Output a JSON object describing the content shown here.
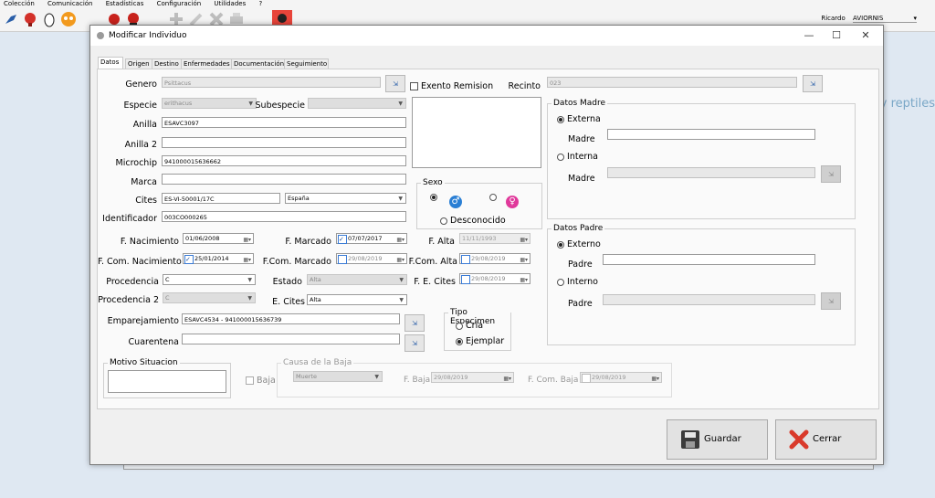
{
  "menubar": [
    "Colección",
    "Comunicación",
    "Estadísticas",
    "Configuración",
    "Utilidades",
    "?"
  ],
  "user": {
    "name": "Ricardo",
    "org": "AVIORNIS"
  },
  "background_text": "y reptiles",
  "dialog": {
    "title": "Modificar Individuo",
    "tabs": [
      "Datos",
      "Origen",
      "Destino",
      "Enfermedades",
      "Documentación",
      "Seguimiento"
    ],
    "active_tab": "Datos"
  },
  "labels": {
    "genero": "Genero",
    "especie": "Especie",
    "subespecie": "Subespecie",
    "anilla": "Anilla",
    "anilla2": "Anilla 2",
    "microchip": "Microchip",
    "marca": "Marca",
    "cites": "Cites",
    "identificador": "Identificador",
    "exento": "Exento Remision",
    "recinto": "Recinto",
    "sexo": "Sexo",
    "desconocido": "Desconocido",
    "f_nacimiento": "F. Nacimiento",
    "f_marcado": "F. Marcado",
    "f_alta": "F. Alta",
    "f_com_nacimiento": "F. Com. Nacimiento",
    "f_com_marcado": "F.Com. Marcado",
    "f_com_alta": "F.Com. Alta",
    "procedencia": "Procedencia",
    "estado": "Estado",
    "f_e_cites": "F. E. Cites",
    "procedencia2": "Procedencia 2",
    "e_cites": "E. Cites",
    "emparejamiento": "Emparejamiento",
    "cuarentena": "Cuarentena",
    "tipo_especimen": "Tipo Especimen",
    "cria": "Cria",
    "ejemplar": "Ejemplar",
    "motivo_situacion": "Motivo Situacion",
    "baja": "Baja",
    "causa_baja": "Causa de la Baja",
    "f_baja": "F. Baja",
    "f_com_baja": "F. Com. Baja"
  },
  "values": {
    "genero": "Psittacus",
    "especie": "erithacus",
    "subespecie": "",
    "anilla": "ESAVC3097",
    "anilla2": "",
    "microchip": "941000015636662",
    "marca": "",
    "cites": "ES-VI-50001/17C",
    "cites_country": "España",
    "identificador": "003CO000265",
    "recinto": "023",
    "f_nacimiento": "01/06/2008",
    "f_marcado": "07/07/2017",
    "f_alta": "11/11/1993",
    "f_com_nacimiento": "25/01/2014",
    "f_com_marcado": "29/08/2019",
    "f_com_alta": "29/08/2019",
    "procedencia": "C",
    "estado": "Alta",
    "f_e_cites": "29/08/2019",
    "procedencia2": "C",
    "e_cites": "Alta",
    "emparejamiento": "ESAVC4534 - 941000015636739",
    "cuarentena": "",
    "causa_baja": "Muerte",
    "f_baja": "29/08/2019",
    "f_com_baja": "29/08/2019"
  },
  "madre": {
    "title": "Datos Madre",
    "externa": "Externa",
    "interna": "Interna",
    "madre_label": "Madre"
  },
  "padre": {
    "title": "Datos Padre",
    "externo": "Externo",
    "interno": "Interno",
    "padre_label": "Padre"
  },
  "buttons": {
    "guardar": "Guardar",
    "cerrar": "Cerrar"
  },
  "colors": {
    "male": "#2a7fd4",
    "female": "#e0399b",
    "accent": "#3a7bd5",
    "close_red": "#d93a2b"
  }
}
